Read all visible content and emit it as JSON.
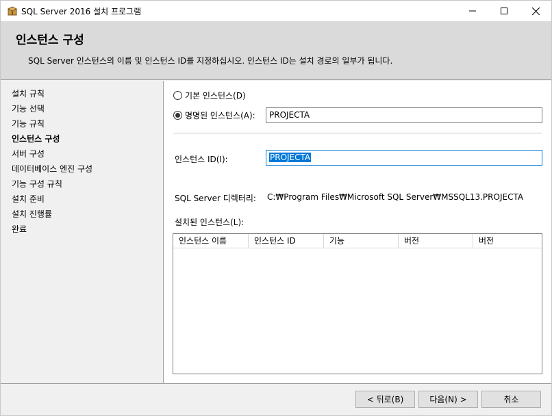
{
  "window": {
    "title": "SQL Server 2016 설치 프로그램"
  },
  "header": {
    "title": "인스턴스 구성",
    "description": "SQL Server 인스턴스의 이름 및 인스턴스 ID를 지정하십시오. 인스턴스 ID는 설치 경로의 일부가 됩니다."
  },
  "nav": {
    "items": [
      {
        "label": "설치 규칙",
        "active": false
      },
      {
        "label": "기능 선택",
        "active": false
      },
      {
        "label": "기능 규칙",
        "active": false
      },
      {
        "label": "인스턴스 구성",
        "active": true
      },
      {
        "label": "서버 구성",
        "active": false
      },
      {
        "label": "데이터베이스 엔진 구성",
        "active": false
      },
      {
        "label": "기능 구성 규칙",
        "active": false
      },
      {
        "label": "설치 준비",
        "active": false
      },
      {
        "label": "설치 진행률",
        "active": false
      },
      {
        "label": "완료",
        "active": false
      }
    ]
  },
  "form": {
    "default_instance_label": "기본 인스턴스(D)",
    "named_instance_label": "명명된 인스턴스(A):",
    "named_instance_value": "PROJECTA",
    "instance_id_label": "인스턴스 ID(I):",
    "instance_id_value": "PROJECTA",
    "directory_label": "SQL Server 디렉터리:",
    "directory_value": "C:₩Program Files₩Microsoft SQL Server₩MSSQL13.PROJECTA",
    "installed_label": "설치된 인스턴스(L):"
  },
  "table": {
    "columns": [
      "인스턴스 이름",
      "인스턴스 ID",
      "기능",
      "버전",
      "버전"
    ]
  },
  "footer": {
    "back_label": "< 뒤로(B)",
    "next_label": "다음(N) >",
    "cancel_label": "취소"
  }
}
